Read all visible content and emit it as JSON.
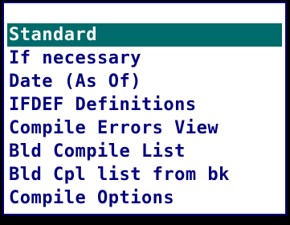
{
  "menu": {
    "items": [
      {
        "label": "Standard",
        "selected": true
      },
      {
        "label": "If necessary",
        "selected": false
      },
      {
        "label": "Date (As Of)",
        "selected": false
      },
      {
        "label": "IFDEF Definitions",
        "selected": false
      },
      {
        "label": "Compile Errors View",
        "selected": false
      },
      {
        "label": "Bld Compile List",
        "selected": false
      },
      {
        "label": "Bld Cpl list from bk",
        "selected": false
      },
      {
        "label": "Compile Options",
        "selected": false
      }
    ]
  },
  "colors": {
    "frame": "#000000",
    "text": "#000080",
    "selected_bg": "#006b6b",
    "selected_text": "#ffffff",
    "panel_bg": "#ffffff"
  }
}
